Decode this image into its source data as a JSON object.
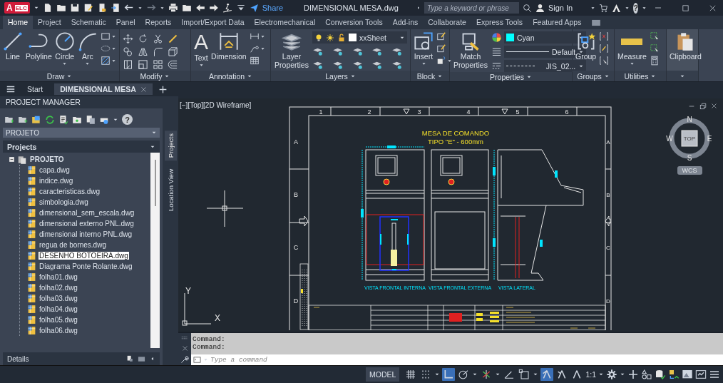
{
  "title_bar": {
    "app_logo": "A",
    "app_badge": "ELC",
    "share": "Share",
    "title": "DIMENSIONAL MESA.dwg",
    "search": {
      "placeholder": "Type a keyword or phrase"
    },
    "sign_in": "Sign In",
    "help": "?"
  },
  "ribbon_tabs": [
    {
      "label": "Home",
      "selected": true
    },
    {
      "label": "Project",
      "selected": false
    },
    {
      "label": "Schematic",
      "selected": false
    },
    {
      "label": "Panel",
      "selected": false
    },
    {
      "label": "Reports",
      "selected": false
    },
    {
      "label": "Import/Export Data",
      "selected": false
    },
    {
      "label": "Electromechanical",
      "selected": false
    },
    {
      "label": "Conversion Tools",
      "selected": false
    },
    {
      "label": "Add-ins",
      "selected": false
    },
    {
      "label": "Collaborate",
      "selected": false
    },
    {
      "label": "Express Tools",
      "selected": false
    },
    {
      "label": "Featured Apps",
      "selected": false
    }
  ],
  "ribbon_panels": [
    {
      "kind": "draw",
      "title": "Draw",
      "tools": [
        {
          "label": "Line",
          "menu": false
        },
        {
          "label": "Polyline",
          "menu": false
        },
        {
          "label": "Circle",
          "menu": true
        },
        {
          "label": "Arc",
          "menu": true
        }
      ]
    },
    {
      "kind": "modify",
      "title": "Modify"
    },
    {
      "kind": "annotation",
      "title": "Annotation",
      "tools": [
        {
          "label": "Text",
          "menu": true,
          "glyph": "A"
        },
        {
          "label": "Dimension",
          "menu": false
        }
      ]
    },
    {
      "kind": "layers",
      "title": "Layers",
      "tools": [
        {
          "label": "Layer Properties",
          "menu": false
        }
      ],
      "layer": "xxSheet"
    },
    {
      "kind": "block",
      "title": "Block",
      "tools": [
        {
          "label": "Insert",
          "menu": true
        }
      ]
    },
    {
      "kind": "properties",
      "title": "Properties",
      "tools": [
        {
          "label": "Match Properties",
          "menu": false
        }
      ],
      "color": "#00ffff",
      "color_label": "Cyan",
      "lineweight": "Default",
      "linetype": "JIS_02..."
    },
    {
      "kind": "groups",
      "title": "Groups",
      "tools": [
        {
          "label": "Group",
          "menu": false
        }
      ]
    },
    {
      "kind": "utilities",
      "title": "Utilities",
      "tools": [
        {
          "label": "Measure",
          "menu": true
        }
      ]
    },
    {
      "kind": "clipboard",
      "tools": [
        {
          "label": "Clipboard",
          "menu": false
        }
      ]
    }
  ],
  "document_tabs": [
    {
      "label": "Start",
      "selected": false,
      "closable": false
    },
    {
      "label": "DIMENSIONAL MESA",
      "selected": true,
      "closable": true
    }
  ],
  "project_manager": {
    "title": "PROJECT MANAGER",
    "help": "?",
    "project_select": "PROJETO",
    "section": "Projects",
    "tree": [
      {
        "label": "PROJETO",
        "expanded": true,
        "selected": false,
        "children": [
          {
            "label": "capa.dwg",
            "selected": false
          },
          {
            "label": "indice.dwg",
            "selected": false
          },
          {
            "label": "caracteristicas.dwg",
            "selected": false
          },
          {
            "label": "simbologia.dwg",
            "selected": false
          },
          {
            "label": "dimensional_sem_escala.dwg",
            "selected": false
          },
          {
            "label": "dimensional externo PNL.dwg",
            "selected": false
          },
          {
            "label": "dimensional interno PNL.dwg",
            "selected": false
          },
          {
            "label": "regua de bornes.dwg",
            "selected": false
          },
          {
            "label": "DESENHO BOTOEIRA.dwg",
            "selected": true
          },
          {
            "label": "Diagrama Ponte Rolante.dwg",
            "selected": false
          },
          {
            "label": "folha01.dwg",
            "selected": false
          },
          {
            "label": "folha02.dwg",
            "selected": false
          },
          {
            "label": "folha03.dwg",
            "selected": false
          },
          {
            "label": "folha04.dwg",
            "selected": false
          },
          {
            "label": "folha05.dwg",
            "selected": false
          },
          {
            "label": "folha06.dwg",
            "selected": false
          }
        ]
      }
    ],
    "details": "Details",
    "side_tabs": [
      {
        "label": "Projects",
        "selected": true
      },
      {
        "label": "Location View",
        "selected": false
      }
    ]
  },
  "viewport": {
    "label": "[−][Top][2D Wireframe]",
    "sheet": {
      "column_marks": [
        "1",
        "2",
        "3",
        "4",
        "5",
        "6"
      ],
      "row_marks_left": [
        "A",
        "B",
        "C",
        "D"
      ],
      "row_marks_right": [
        "A",
        "B",
        "C",
        "D"
      ],
      "title": "MESA DE COMANDO",
      "subtitle": "TIPO \"E\" - 600mm",
      "views": [
        {
          "kind": "front_internal",
          "caption": "VISTA FRONTAL INTERNA"
        },
        {
          "kind": "front_external",
          "caption": "VISTA FRONTAL EXTERNA"
        },
        {
          "kind": "side",
          "caption": "VISTA LATERAL"
        }
      ]
    },
    "viewcube": {
      "north": "N",
      "south": "S",
      "east": "E",
      "west": "W",
      "face": "TOP",
      "ucs_menu": "WCS"
    },
    "ucs": {
      "x": "X",
      "y": "Y"
    }
  },
  "command_line": {
    "history": [
      "Command:",
      "Command:"
    ],
    "placeholder": "Type a command"
  },
  "status_bar": {
    "space": "MODEL",
    "toggles": [
      {
        "kind": "grid",
        "on": false
      },
      {
        "kind": "snap",
        "on": false
      },
      {
        "kind": "ortho",
        "on": true
      },
      {
        "kind": "polar",
        "on": false
      },
      {
        "kind": "isodraft",
        "on": false
      },
      {
        "kind": "angle",
        "on": false
      },
      {
        "kind": "osnap",
        "on": false
      },
      {
        "kind": "annovis",
        "on": true
      },
      {
        "kind": "autoscale",
        "on": false
      },
      {
        "kind": "annoscale",
        "on": false
      }
    ],
    "scale": "1:1"
  }
}
